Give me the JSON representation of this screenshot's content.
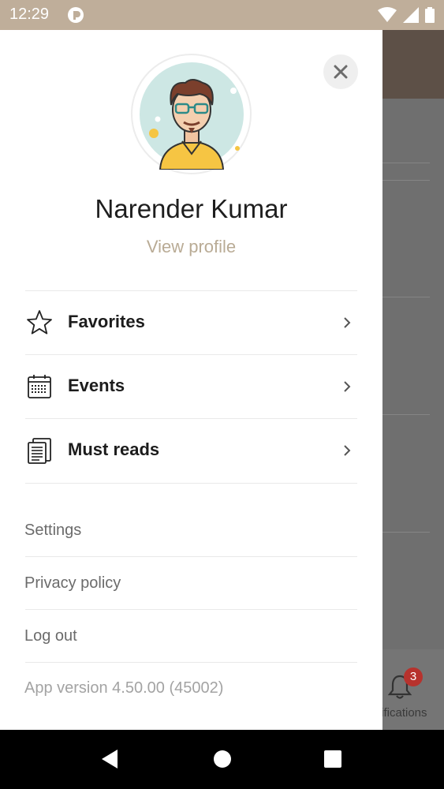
{
  "status_bar": {
    "time": "12:29"
  },
  "drawer": {
    "user_name": "Narender Kumar",
    "view_profile": "View profile",
    "menu": [
      {
        "label": "Favorites",
        "icon": "star-icon"
      },
      {
        "label": "Events",
        "icon": "calendar-icon"
      },
      {
        "label": "Must reads",
        "icon": "document-icon"
      }
    ],
    "links": [
      "Settings",
      "Privacy policy",
      "Log out"
    ],
    "app_version": "App version 4.50.00 (45002)"
  },
  "background": {
    "notifications_label": "tifications",
    "notifications_count": "3"
  },
  "colors": {
    "status_bar": "#bfae9a",
    "accent_text": "#b9ab95",
    "badge": "#b7322d"
  }
}
